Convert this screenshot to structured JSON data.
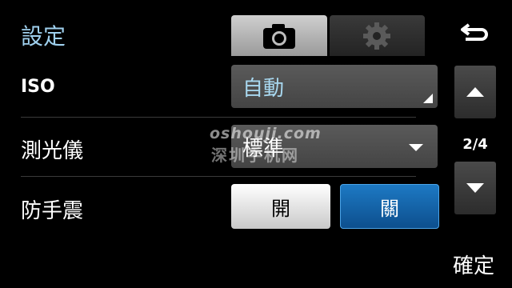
{
  "header": {
    "title": "設定"
  },
  "tabs": [
    {
      "icon": "camera-icon",
      "active": true
    },
    {
      "icon": "gear-icon",
      "active": false
    }
  ],
  "back_icon": "back-arrow-icon",
  "settings": {
    "iso": {
      "label": "ISO",
      "value": "自動"
    },
    "metering": {
      "label": "測光儀",
      "value": "標準"
    },
    "stabilizer": {
      "label": "防手震",
      "on_label": "開",
      "off_label": "關",
      "selected": "關"
    }
  },
  "pager": {
    "indicator": "2/4"
  },
  "footer": {
    "confirm_label": "確定"
  },
  "watermark": {
    "line1": "oshouji.com",
    "line2": "深圳手机网"
  },
  "colors": {
    "selected_blue": "#1d6fb8",
    "title_blue": "#9fd0ee"
  }
}
